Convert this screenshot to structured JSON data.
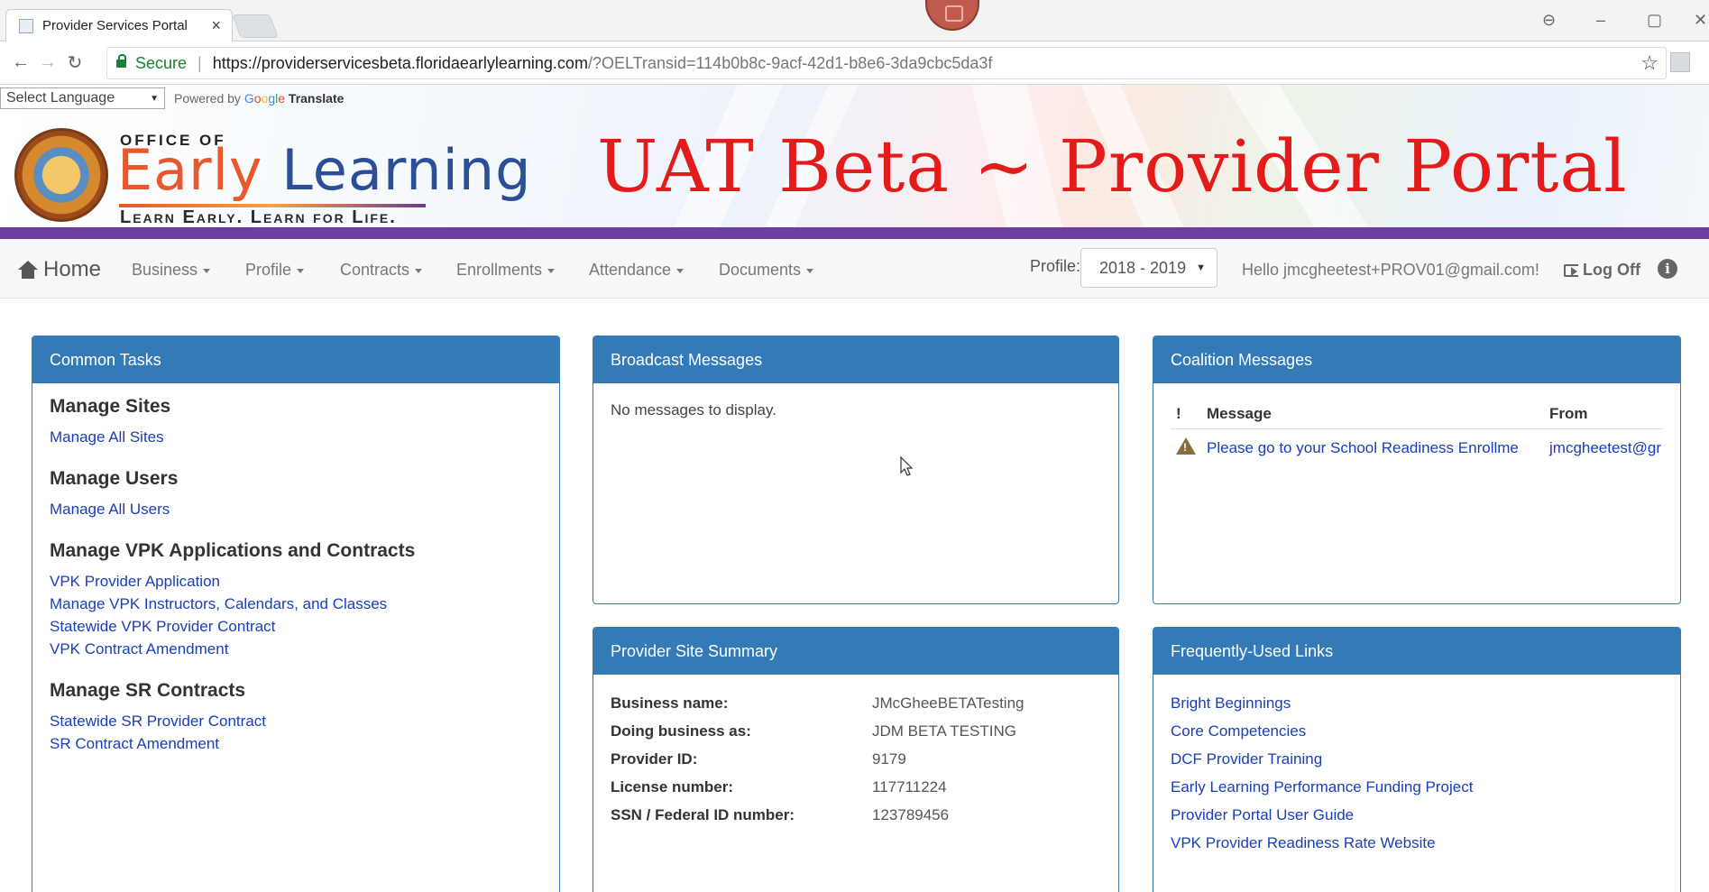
{
  "browser": {
    "tab_title": "Provider Services Portal",
    "tab_close": "×",
    "secure_label": "Secure",
    "url_host": "https://providerservicesbeta.floridaearlylearning.com",
    "url_rest": "/?OELTransid=114b0b8c-9acf-42d1-b8e6-3da9cbc5da3f"
  },
  "translate": {
    "select_value": "Select Language",
    "powered_by": "Powered by",
    "google": [
      "G",
      "o",
      "o",
      "g",
      "l",
      "e"
    ],
    "translate_label": "Translate"
  },
  "logo": {
    "office_of": "OFFICE OF",
    "early": "Early",
    "learning": "Learning",
    "tagline": "Learn Early. Learn for Life."
  },
  "banner_title": "UAT Beta ~ Provider Portal",
  "nav": {
    "home": "Home",
    "menus": [
      "Business",
      "Profile",
      "Contracts",
      "Enrollments",
      "Attendance",
      "Documents"
    ],
    "profile_label": "Profile:",
    "profile_value": "2018 - 2019",
    "greeting": "Hello jmcgheetest+PROV01@gmail.com!",
    "logoff": "Log Off",
    "info": "i"
  },
  "common_tasks": {
    "heading": "Common Tasks",
    "groups": [
      {
        "title": "Manage Sites",
        "links": [
          "Manage All Sites"
        ]
      },
      {
        "title": "Manage Users",
        "links": [
          "Manage All Users"
        ]
      },
      {
        "title": "Manage VPK Applications and Contracts",
        "links": [
          "VPK Provider Application",
          "Manage VPK Instructors, Calendars, and Classes",
          "Statewide VPK Provider Contract",
          "VPK Contract Amendment"
        ]
      },
      {
        "title": "Manage SR Contracts",
        "links": [
          "Statewide SR Provider Contract",
          "SR Contract Amendment"
        ]
      }
    ]
  },
  "broadcast": {
    "heading": "Broadcast Messages",
    "empty": "No messages to display."
  },
  "coalition": {
    "heading": "Coalition Messages",
    "columns": [
      "!",
      "Message",
      "From"
    ],
    "rows": [
      {
        "message": "Please go to your School Readiness Enrollme",
        "from": "jmcgheetest@gr"
      }
    ]
  },
  "site_summary": {
    "heading": "Provider Site Summary",
    "rows": [
      {
        "label": "Business name:",
        "value": "JMcGheeBETATesting"
      },
      {
        "label": "Doing business as:",
        "value": "JDM BETA TESTING"
      },
      {
        "label": "Provider ID:",
        "value": "9179"
      },
      {
        "label": "License number:",
        "value": "117711224"
      },
      {
        "label": "SSN / Federal ID number:",
        "value": "123789456"
      }
    ]
  },
  "links": {
    "heading": "Frequently-Used Links",
    "items": [
      "Bright Beginnings",
      "Core Competencies",
      "DCF Provider Training",
      "Early Learning Performance Funding Project",
      "Provider Portal User Guide",
      "VPK Provider Readiness Rate Website"
    ]
  },
  "colors": {
    "panel_blue": "#337ab7",
    "link_blue": "#1a3eb7",
    "banner_red": "#e41b1b",
    "strip_purple": "#6c3e9e"
  }
}
